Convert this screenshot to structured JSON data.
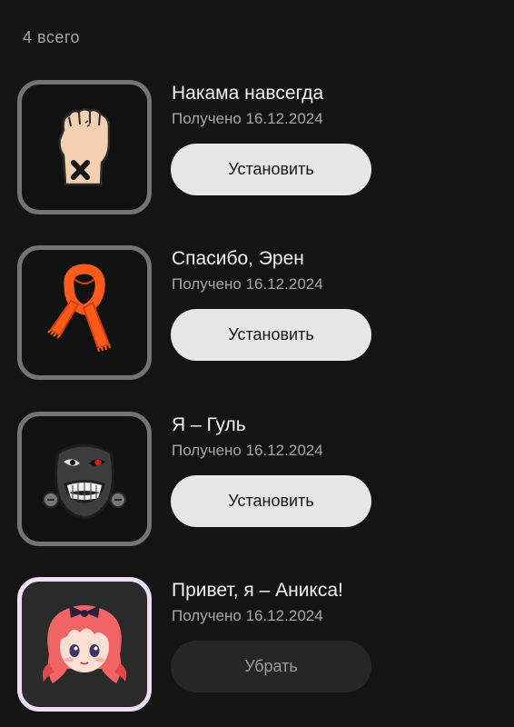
{
  "summary": {
    "count_label": "4 всего"
  },
  "items": [
    {
      "icon": "raised-fist-icon",
      "title": "Накама навсегда",
      "received": "Получено 16.12.2024",
      "action_label": "Установить",
      "selected": false
    },
    {
      "icon": "orange-scarf-icon",
      "title": "Спасибо, Эрен",
      "received": "Получено 16.12.2024",
      "action_label": "Установить",
      "selected": false
    },
    {
      "icon": "ghoul-mask-icon",
      "title": "Я – Гуль",
      "received": "Получено 16.12.2024",
      "action_label": "Установить",
      "selected": false
    },
    {
      "icon": "anime-girl-avatar-icon",
      "title": "Привет, я – Аникса!",
      "received": "Получено 16.12.2024",
      "action_label": "Убрать",
      "selected": true
    }
  ],
  "colors": {
    "background": "#141414",
    "frame_border": "#747474",
    "frame_border_selected": "#ecdff5",
    "button_primary": "#e6e6e6",
    "button_secondary": "#262626",
    "secondary_text": "#a6a6a6"
  }
}
